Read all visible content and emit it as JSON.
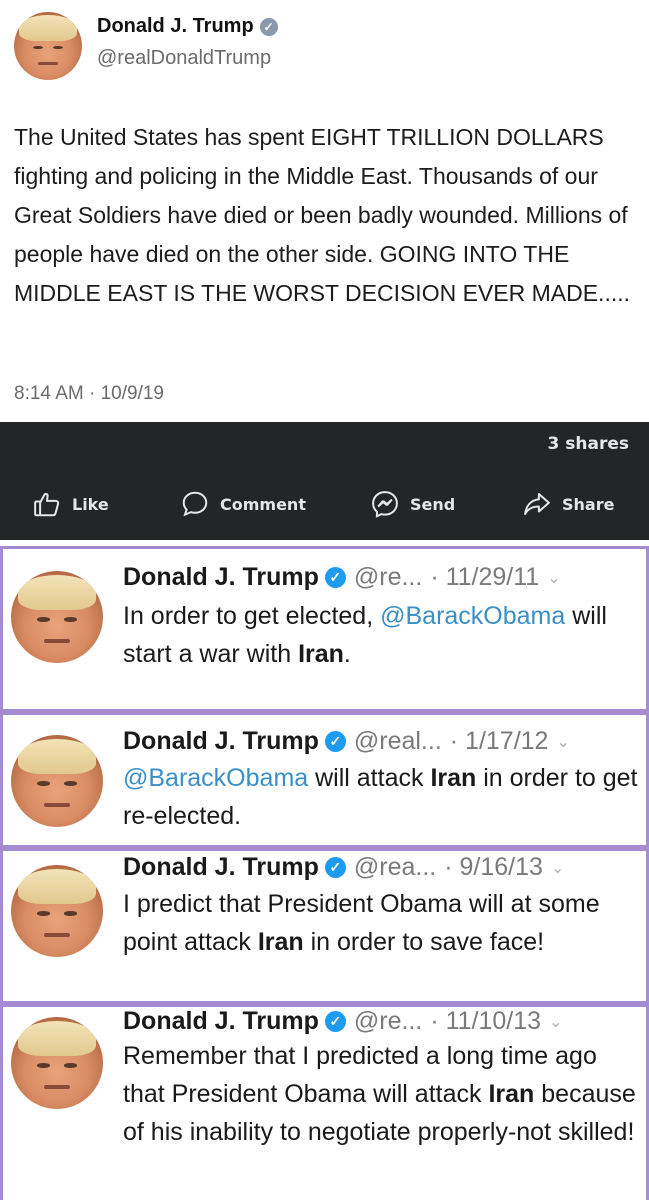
{
  "top_tweet": {
    "name": "Donald J. Trump",
    "handle": "@realDonaldTrump",
    "text": "The United States has spent EIGHT TRILLION DOLLARS fighting and policing in the Middle East. Thousands of our Great Soldiers have died or been badly wounded. Millions of people have died on the other side. GOING INTO THE MIDDLE EAST IS THE WORST DECISION EVER MADE.....",
    "timestamp": "8:14 AM · 10/9/19",
    "verified_icon": "verified-badge-icon"
  },
  "share_bar": {
    "shares": "3 shares",
    "actions": [
      {
        "label": "Like",
        "icon": "thumbs-up-icon"
      },
      {
        "label": "Comment",
        "icon": "comment-bubble-icon"
      },
      {
        "label": "Send",
        "icon": "messenger-icon"
      },
      {
        "label": "Share",
        "icon": "share-arrow-icon"
      }
    ],
    "background": "#242526"
  },
  "old_tweets": [
    {
      "name": "Donald J. Trump",
      "handle": "@re...",
      "date": "· 11/29/11",
      "body_parts": [
        "In order to get elected, ",
        "@BarackObama",
        " will start a war with ",
        "Iran",
        "."
      ]
    },
    {
      "name": "Donald J. Trump",
      "handle": "@real...",
      "date": "· 1/17/12",
      "body_parts": [
        "@BarackObama",
        " will attack ",
        "Iran",
        " in order to get re-elected."
      ]
    },
    {
      "name": "Donald J. Trump",
      "handle": "@rea...",
      "date": "· 9/16/13",
      "body_parts": [
        "I predict that President Obama will at some point attack ",
        "Iran",
        " in order to save face!"
      ]
    },
    {
      "name": "Donald J. Trump",
      "handle": "@re...",
      "date": "· 11/10/13",
      "body_parts": [
        "Remember that I predicted a long time ago that President Obama will attack ",
        "Iran",
        " because of his inability to negotiate properly-not skilled!"
      ]
    }
  ],
  "colors": {
    "mention": "#3b8fc9",
    "verified_blue": "#1d9bf0",
    "frame_border": "#a58bd4"
  }
}
